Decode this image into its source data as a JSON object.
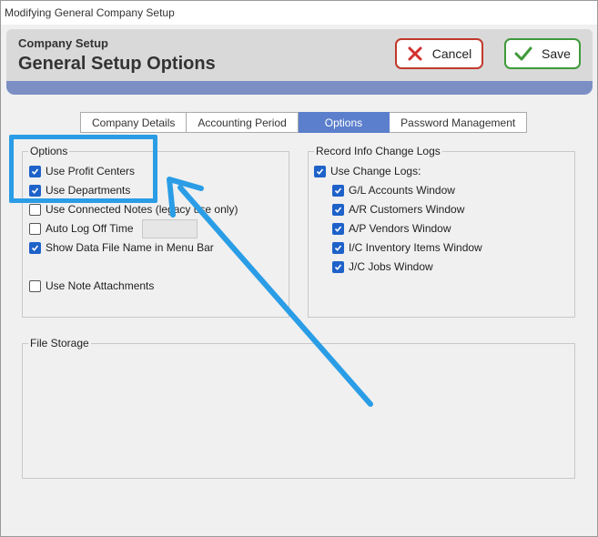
{
  "window": {
    "title": "Modifying General Company Setup"
  },
  "header": {
    "subtitle": "Company Setup",
    "title": "General Setup Options",
    "cancel_label": "Cancel",
    "save_label": "Save"
  },
  "tabs": [
    {
      "label": "Company Details",
      "active": false
    },
    {
      "label": "Accounting Period",
      "active": false
    },
    {
      "label": "Options",
      "active": true
    },
    {
      "label": "Password Management",
      "active": false
    }
  ],
  "options": {
    "label": "Options",
    "items": [
      {
        "label": "Use Profit Centers",
        "checked": true
      },
      {
        "label": "Use Departments",
        "checked": true
      },
      {
        "label": "Use Connected Notes (legacy use only)",
        "checked": false
      },
      {
        "label": "Auto Log Off Time",
        "checked": false
      },
      {
        "label": "Show Data File Name in Menu Bar",
        "checked": true
      },
      {
        "label": "Use Note Attachments",
        "checked": false
      }
    ]
  },
  "record_logs": {
    "label": "Record Info Change Logs",
    "use_change_logs": {
      "label": "Use Change Logs:",
      "checked": true
    },
    "items": [
      {
        "label": "G/L Accounts Window",
        "checked": true
      },
      {
        "label": "A/R Customers Window",
        "checked": true
      },
      {
        "label": "A/P Vendors Window",
        "checked": true
      },
      {
        "label": "I/C Inventory Items Window",
        "checked": true
      },
      {
        "label": "J/C Jobs Window",
        "checked": true
      }
    ]
  },
  "file_storage": {
    "label": "File Storage"
  },
  "colors": {
    "accent": "#5b7fcc",
    "cancel_border": "#c0392b",
    "save_border": "#3e9a3a",
    "annotation": "#2a9de6",
    "checkbox": "#1e62c9"
  },
  "icons": {
    "cancel": "x-icon",
    "save": "checkmark-icon"
  }
}
